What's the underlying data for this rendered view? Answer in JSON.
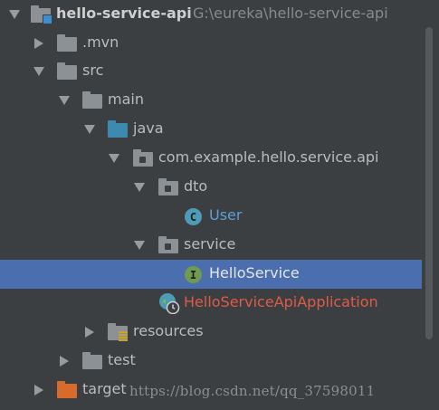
{
  "project": {
    "name": "hello-service-api",
    "path": "G:\\eureka\\hello-service-api"
  },
  "tree": {
    "mvn": ".mvn",
    "src": "src",
    "main": "main",
    "java": "java",
    "package": "com.example.hello.service.api",
    "dto": "dto",
    "user": "User",
    "service": "service",
    "hello_service": "HelloService",
    "application": "HelloServiceApiApplication",
    "resources": "resources",
    "test": "test",
    "target": "target"
  },
  "icons": {
    "class_letter": "C",
    "interface_letter": "I"
  },
  "watermark": "https://blog.csdn.net/qq_37598011",
  "colors": {
    "background": "#3c3f41",
    "selection": "#4b6eaf",
    "class_label": "#5f9fd4",
    "error_label": "#de5a4a"
  }
}
